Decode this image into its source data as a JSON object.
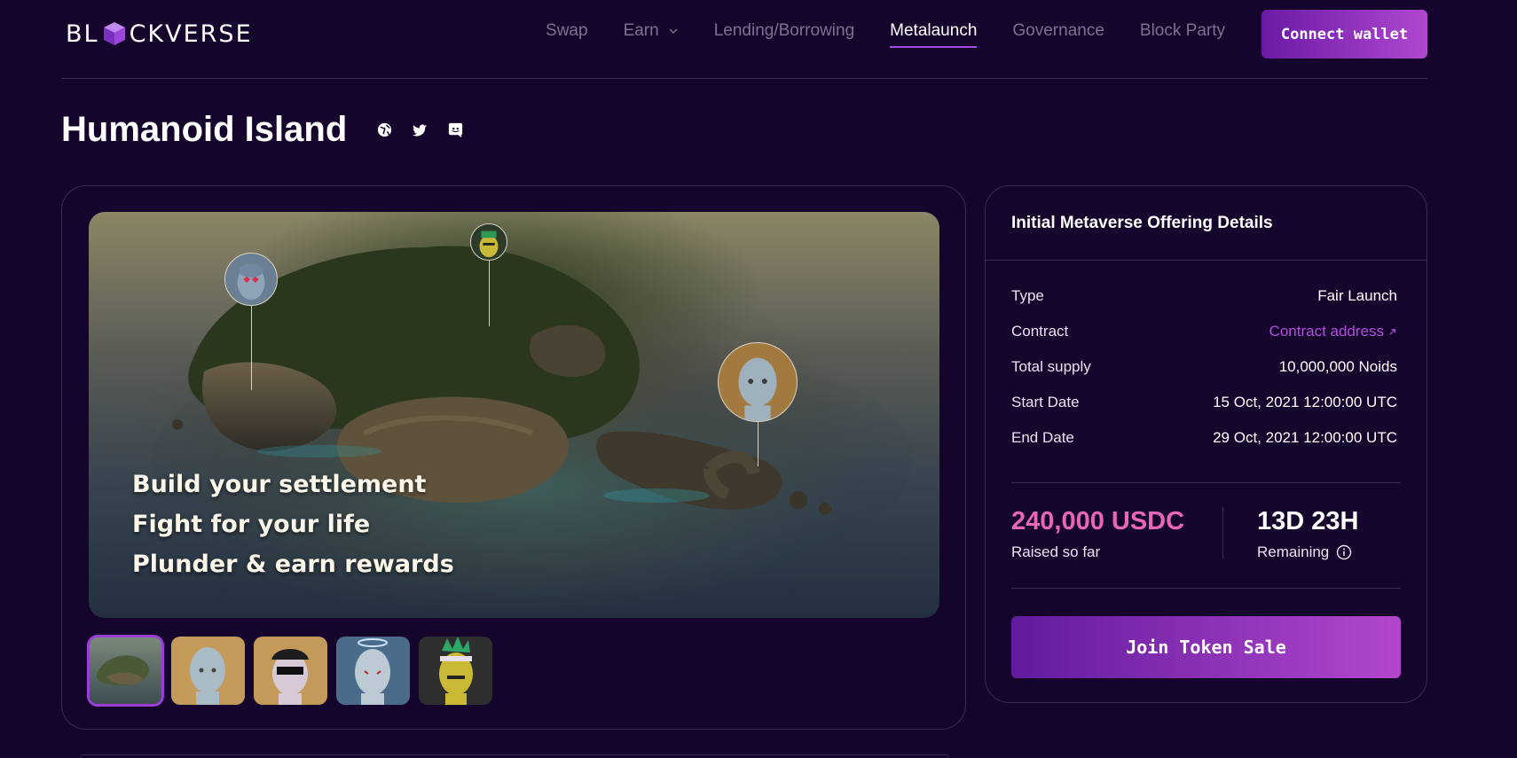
{
  "brand": {
    "logo_left": "BL",
    "logo_right": "CKVERSE"
  },
  "nav": {
    "items": [
      {
        "label": "Swap",
        "active": false,
        "dropdown": false
      },
      {
        "label": "Earn",
        "active": false,
        "dropdown": true
      },
      {
        "label": "Lending/Borrowing",
        "active": false,
        "dropdown": false
      },
      {
        "label": "Metalaunch",
        "active": true,
        "dropdown": false
      },
      {
        "label": "Governance",
        "active": false,
        "dropdown": false
      },
      {
        "label": "Block Party",
        "active": false,
        "dropdown": false
      }
    ],
    "connect_label": "Connect wallet"
  },
  "project": {
    "title": "Humanoid Island",
    "socials": [
      "globe-icon",
      "twitter-icon",
      "discord-icon"
    ]
  },
  "hero": {
    "lines": [
      "Build your settlement",
      "Fight for your life",
      "Plunder & earn rewards"
    ]
  },
  "thumbnails": [
    {
      "name": "island",
      "selected": true
    },
    {
      "name": "noid-plain",
      "selected": false
    },
    {
      "name": "noid-cap-sunglasses",
      "selected": false
    },
    {
      "name": "noid-halo",
      "selected": false
    },
    {
      "name": "noid-yellow-mohawk",
      "selected": false
    }
  ],
  "details": {
    "title": "Initial Metaverse Offering Details",
    "rows": [
      {
        "label": "Type",
        "value": "Fair Launch"
      },
      {
        "label": "Contract",
        "value": "Contract address"
      },
      {
        "label": "Total supply",
        "value": "10,000,000 Noids"
      },
      {
        "label": "Start Date",
        "value": "15 Oct, 2021 12:00:00 UTC"
      },
      {
        "label": "End Date",
        "value": "29 Oct, 2021 12:00:00 UTC"
      }
    ],
    "raised_value": "240,000 USDC",
    "raised_label": "Raised so far",
    "remaining_value": "13D 23H",
    "remaining_label": "Remaining",
    "join_label": "Join Token Sale"
  },
  "colors": {
    "background": "#15042c",
    "accent": "#a14be0",
    "raised": "#e866b8",
    "link": "#b150db"
  }
}
